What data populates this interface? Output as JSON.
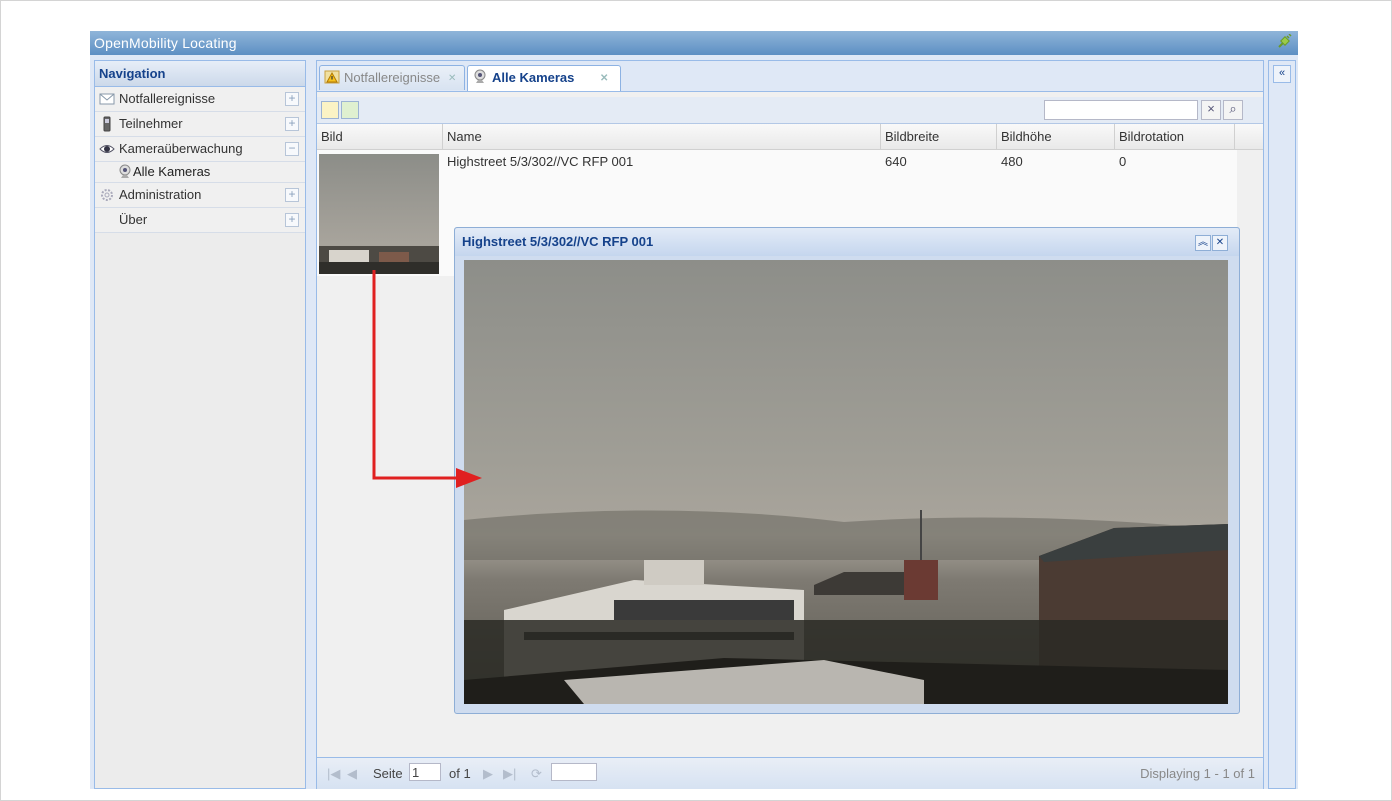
{
  "app": {
    "title": "OpenMobility Locating"
  },
  "navigation": {
    "title": "Navigation",
    "items": [
      {
        "label": "Notfallereignisse",
        "icon": "envelope-icon",
        "toggle": "+"
      },
      {
        "label": "Teilnehmer",
        "icon": "phone-icon",
        "toggle": "+"
      },
      {
        "label": "Kameraüberwachung",
        "icon": "eye-icon",
        "toggle": "−"
      },
      {
        "label": "Administration",
        "icon": "gear-icon",
        "toggle": "+"
      },
      {
        "label": "Über",
        "icon": "",
        "toggle": "+"
      }
    ],
    "sub_items": [
      {
        "label": "Alle Kameras",
        "icon": "webcam-icon"
      }
    ]
  },
  "tabs": [
    {
      "label": "Notfallereignisse",
      "icon": "warning-icon",
      "active": false
    },
    {
      "label": "Alle Kameras",
      "icon": "webcam-icon",
      "active": true
    }
  ],
  "grid": {
    "columns": [
      "Bild",
      "Name",
      "Bildbreite",
      "Bildhöhe",
      "Bildrotation"
    ],
    "rows": [
      {
        "name": "Highstreet 5/3/302//VC RFP 001",
        "width": "640",
        "height": "480",
        "rotation": "0"
      }
    ]
  },
  "pager": {
    "page_label": "Seite",
    "page_value": "1",
    "of_label": "of 1",
    "displaying": "Displaying 1 - 1 of 1"
  },
  "popup": {
    "title": "Highstreet 5/3/302//VC RFP 001"
  },
  "colors": {
    "accent": "#15428b",
    "titlebar": "#5d8fc3",
    "arrow": "#e02020"
  }
}
